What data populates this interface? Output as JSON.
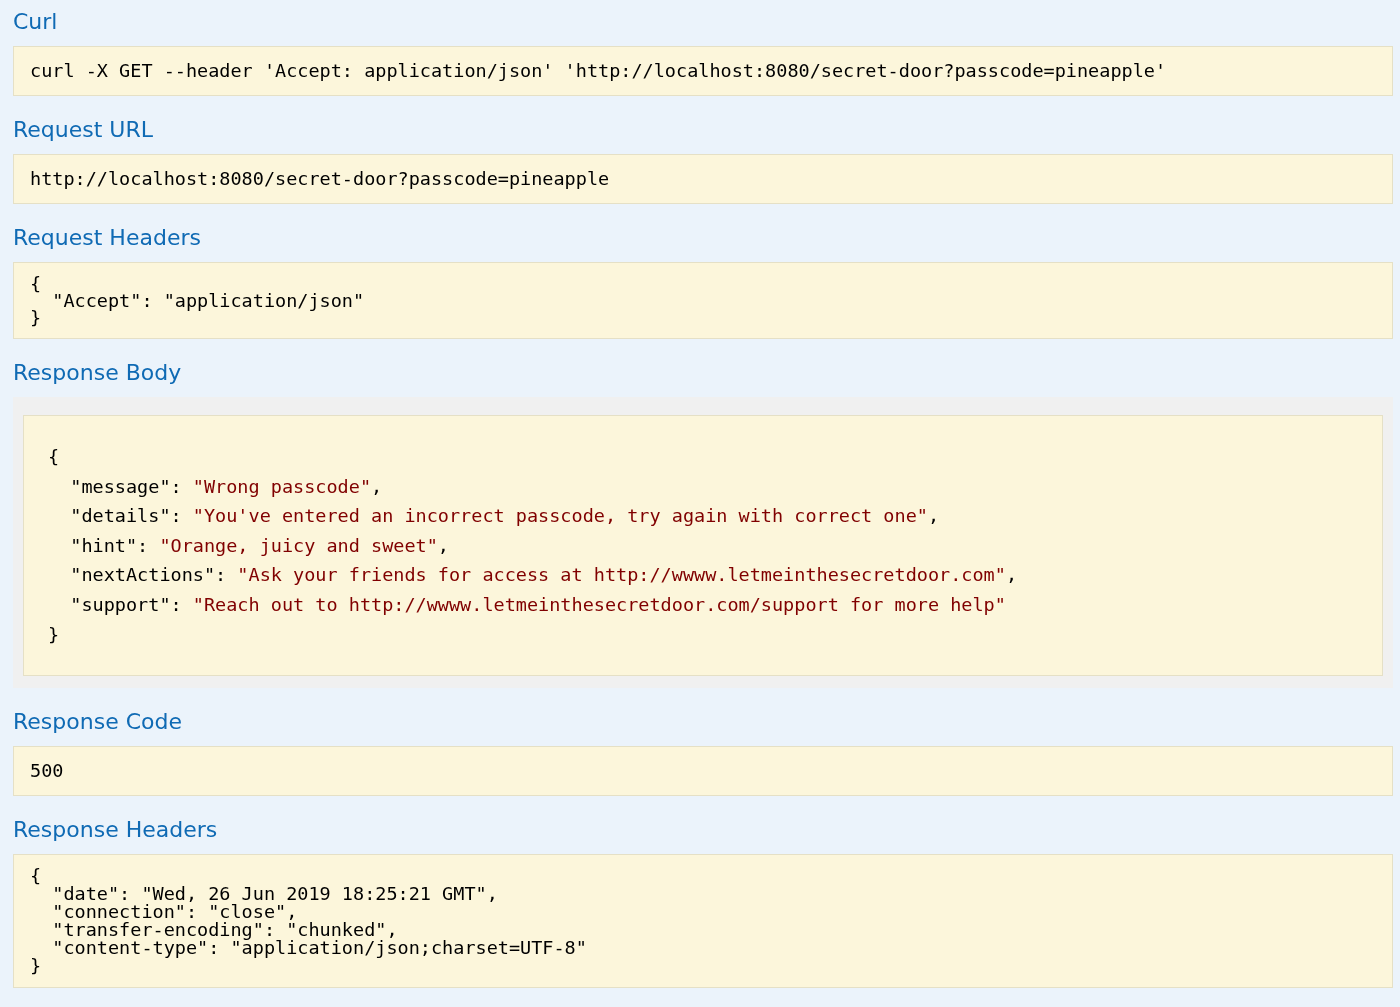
{
  "sections": [
    {
      "title": "Curl",
      "kind": "block",
      "lines": [
        "curl -X GET --header 'Accept: application/json' 'http://localhost:8080/secret-door?passcode=pineapple'"
      ]
    },
    {
      "title": "Request URL",
      "kind": "block",
      "lines": [
        "http://localhost:8080/secret-door?passcode=pineapple"
      ]
    },
    {
      "title": "Request Headers",
      "kind": "block",
      "lines": [
        "{",
        "  \"Accept\": \"application/json\"",
        "}"
      ]
    },
    {
      "title": "Response Body",
      "kind": "highlight",
      "open": "{",
      "close": "}",
      "entries": [
        {
          "key": "\"message\":",
          "value": "\"Wrong passcode\"",
          "tail": ","
        },
        {
          "key": "\"details\":",
          "value": "\"You've entered an incorrect passcode, try again with correct one\"",
          "tail": ","
        },
        {
          "key": "\"hint\":",
          "value": "\"Orange, juicy and sweet\"",
          "tail": ","
        },
        {
          "key": "\"nextActions\":",
          "value": "\"Ask your friends for access at http://wwww.letmeinthesecretdoor.com\"",
          "tail": ","
        },
        {
          "key": "\"support\":",
          "value": "\"Reach out to http://wwww.letmeinthesecretdoor.com/support for more help\""
        }
      ]
    },
    {
      "title": "Response Code",
      "kind": "block",
      "lines": [
        "500"
      ]
    },
    {
      "title": "Response Headers",
      "kind": "compact",
      "lines": [
        "{",
        "  \"date\": \"Wed, 26 Jun 2019 18:25:21 GMT\",",
        "  \"connection\": \"close\",",
        "  \"transfer-encoding\": \"chunked\",",
        "  \"content-type\": \"application/json;charset=UTF-8\"",
        "}"
      ]
    }
  ]
}
